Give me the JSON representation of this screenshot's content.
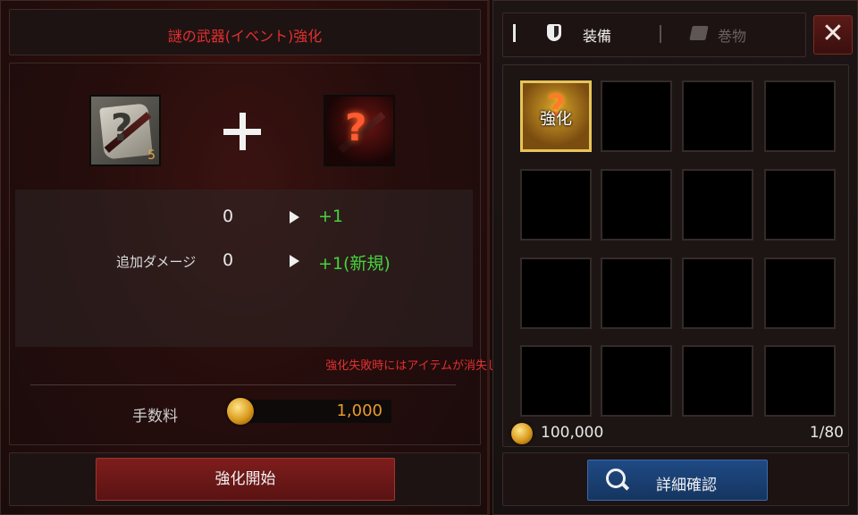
{
  "enhance": {
    "title": "謎の武器(イベント)強化",
    "material_count": "5",
    "stats": [
      {
        "label": "",
        "before": "0",
        "after": "+1"
      },
      {
        "label": "追加ダメージ",
        "before": "0",
        "after": "+1(新規)"
      }
    ],
    "warning": "強化失敗時にはアイテムが消失します。",
    "fee_label": "手数料",
    "fee_value": "1,000",
    "start_button": "強化開始"
  },
  "inventory": {
    "tabs": [
      {
        "label": "装備",
        "icon": "shield-icon",
        "active": true
      },
      {
        "label": "巻物",
        "icon": "scroll-icon",
        "active": false
      }
    ],
    "close_label": "✕",
    "selected_item_label": "強化",
    "gold": "100,000",
    "slot_count": "1/80",
    "detail_button": "詳細確認"
  },
  "colors": {
    "title_red": "#e23030",
    "stat_green": "#46d23c",
    "fee_orange": "#e89a2c",
    "start_button": "#7e1d1c",
    "detail_button": "#1f4a84",
    "selected_border": "#e7c45a"
  }
}
